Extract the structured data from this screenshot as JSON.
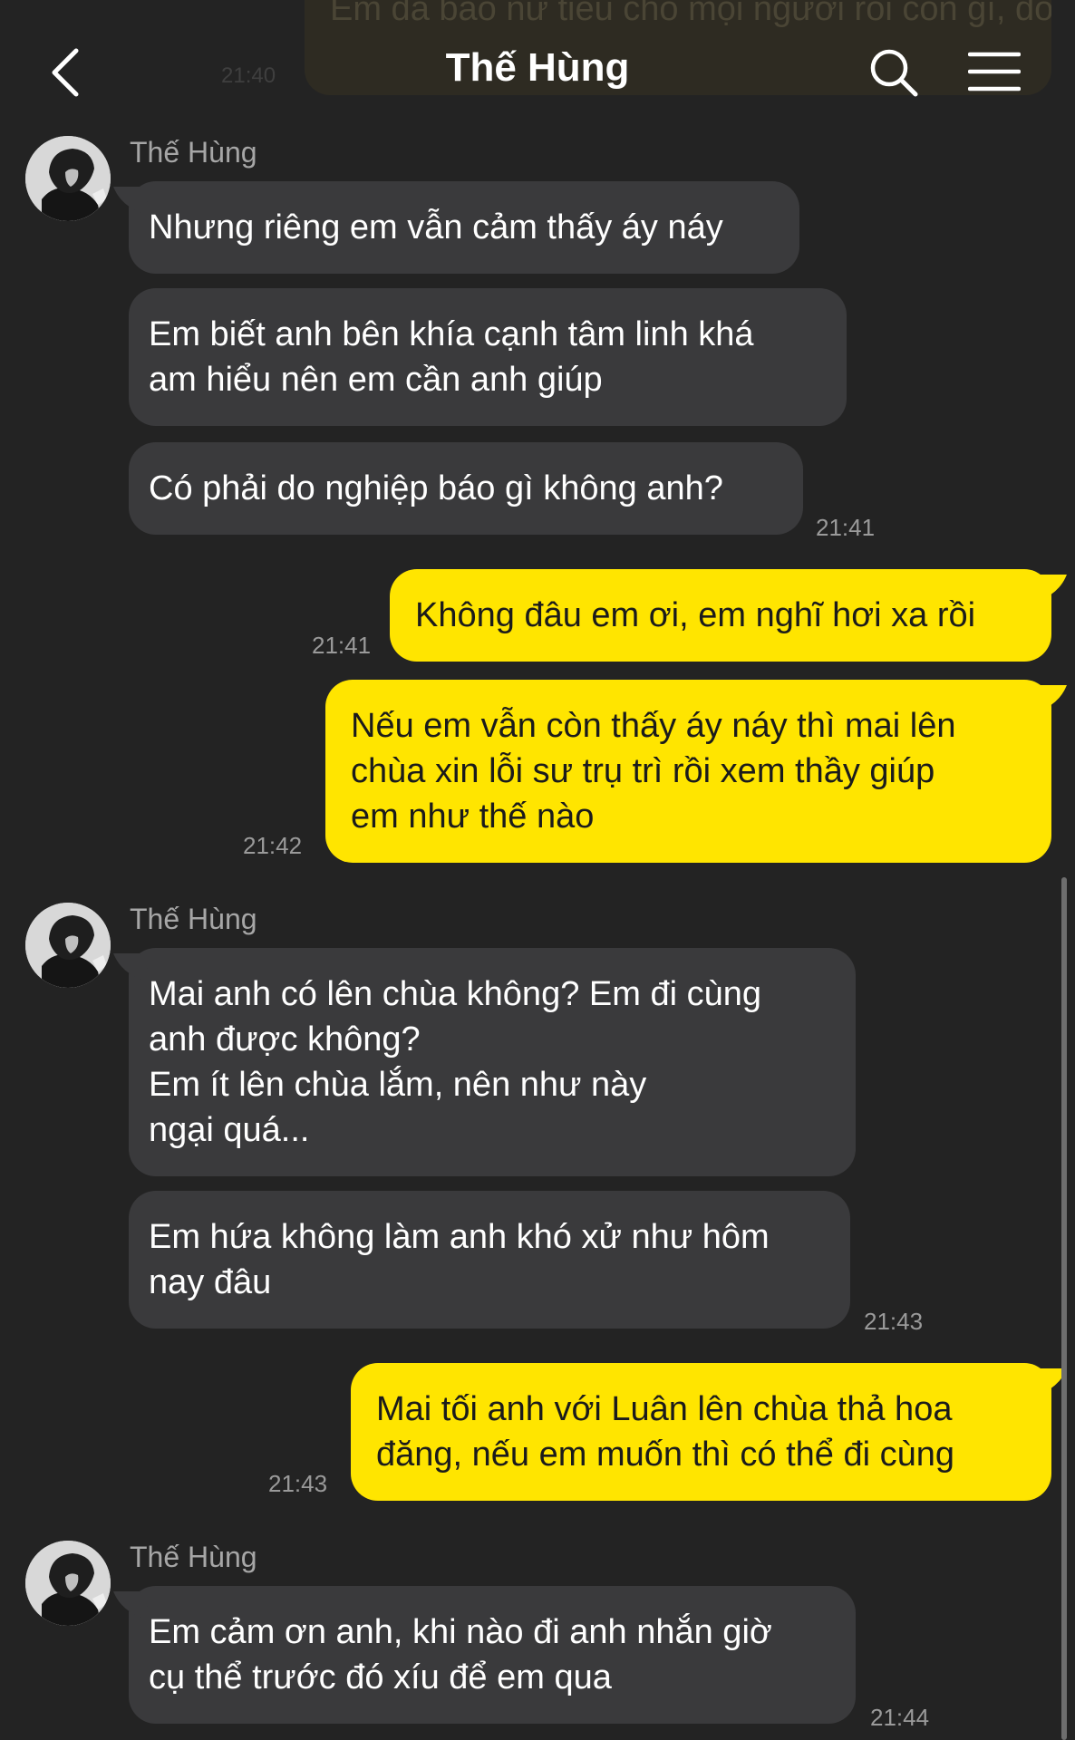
{
  "header": {
    "title": "Thế Hùng",
    "back_icon": "chevron-left-icon",
    "search_icon": "search-icon",
    "menu_icon": "hamburger-menu-icon"
  },
  "peek": {
    "text": "Em đã báo nữ tiêu cho mọi người rồi còn\ngì, đó cũng là một cách xin lỗi",
    "time": "21:40"
  },
  "colors": {
    "background": "#232323",
    "incoming_bubble": "#3a3a3c",
    "outgoing_bubble": "#ffe500"
  },
  "messages": {
    "g1": {
      "sender": "Thế Hùng",
      "m1": "Nhưng riêng em vẫn cảm thấy áy náy",
      "m2": "Em biết anh bên khía cạnh tâm linh khá\nam hiểu nên em cần anh giúp",
      "m3": "Có phải do nghiệp báo gì không anh?",
      "time": "21:41"
    },
    "o1": {
      "text": "Không đâu em ơi, em nghĩ hơi xa rồi",
      "time": "21:41"
    },
    "o2": {
      "text": "Nếu em vẫn còn thấy áy náy thì mai lên\nchùa xin lỗi sư trụ trì rồi xem thầy giúp\nem như thế nào",
      "time": "21:42"
    },
    "g2": {
      "sender": "Thế Hùng",
      "m1": "Mai anh có lên chùa không? Em đi cùng\nanh được không?\nEm ít lên chùa lắm, nên như này\nngại quá...",
      "m2": "Em hứa không làm anh khó xử như hôm\nnay đâu",
      "time": "21:43"
    },
    "o3": {
      "text": "Mai tối anh với Luân lên chùa thả hoa\nđăng, nếu em muốn thì có thể đi cùng",
      "time": "21:43"
    },
    "g3": {
      "sender": "Thế Hùng",
      "m1": "Em cảm ơn anh, khi nào đi anh nhắn giờ\ncụ thể trước đó xíu để em qua",
      "time": "21:44"
    }
  }
}
